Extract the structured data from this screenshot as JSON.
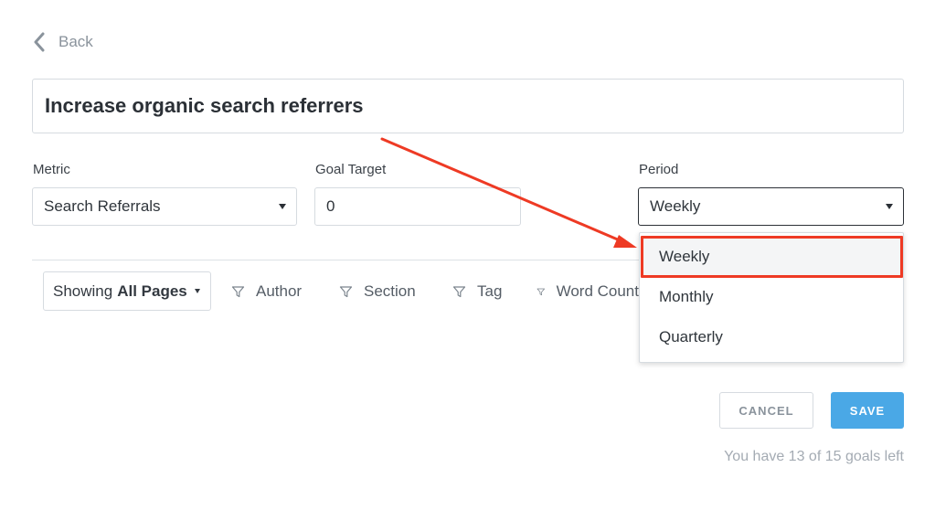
{
  "back": {
    "label": "Back"
  },
  "goal_title": "Increase organic search referrers",
  "fields": {
    "metric": {
      "label": "Metric",
      "value": "Search Referrals"
    },
    "goal_target": {
      "label": "Goal Target",
      "value": "0"
    },
    "period": {
      "label": "Period",
      "value": "Weekly"
    }
  },
  "period_dropdown": {
    "options": [
      "Weekly",
      "Monthly",
      "Quarterly"
    ],
    "selected": "Weekly"
  },
  "filters": {
    "showing_prefix": "Showing",
    "showing_value": "All Pages",
    "items": [
      "Author",
      "Section",
      "Tag",
      "Word Count"
    ]
  },
  "actions": {
    "cancel": "CANCEL",
    "save": "SAVE"
  },
  "goals_left": "You have 13 of 15 goals left",
  "colors": {
    "annotation": "#ee3a24",
    "primary": "#4aa8e6"
  }
}
